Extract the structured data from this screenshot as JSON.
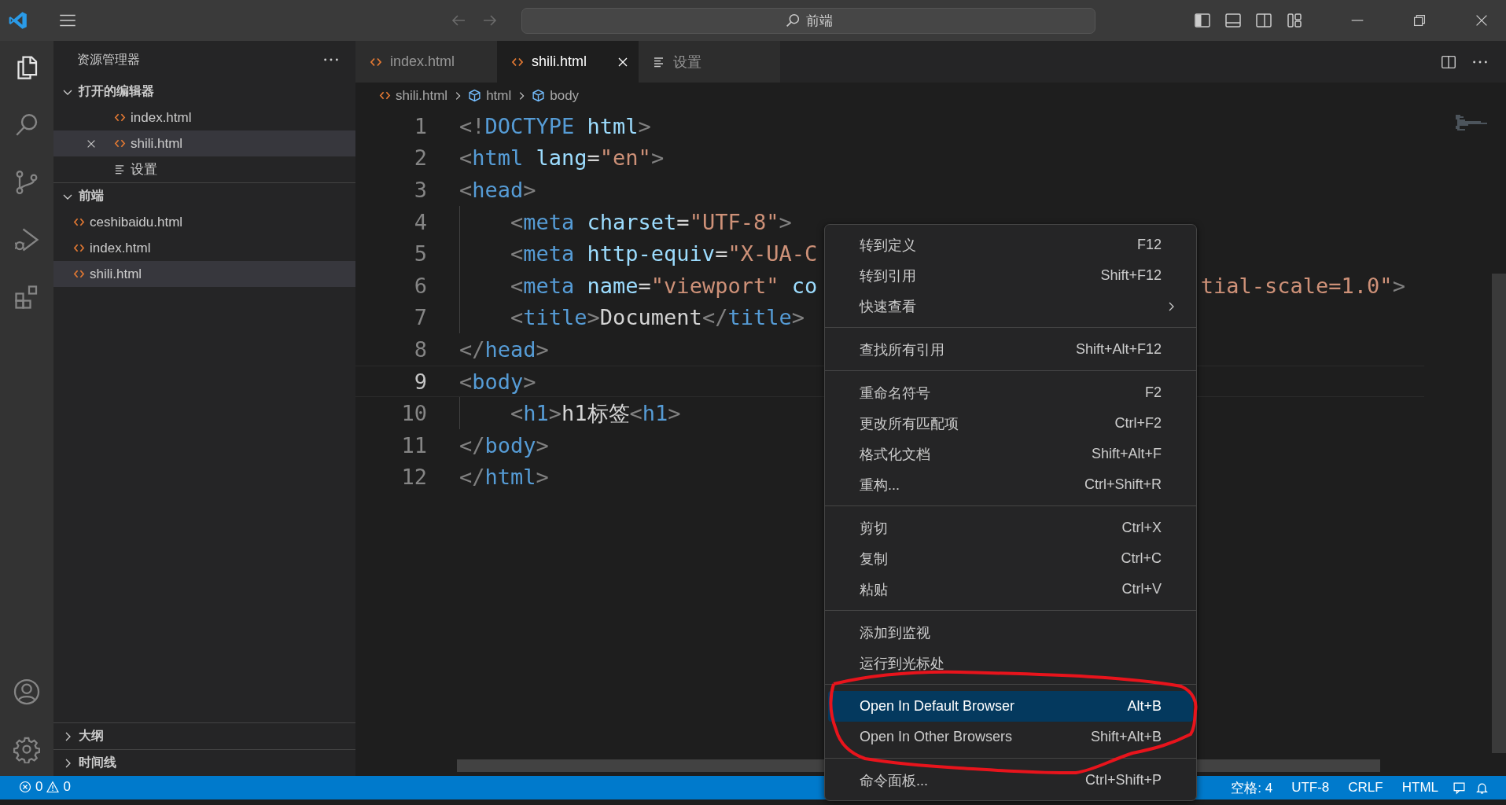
{
  "title_bar": {
    "search": "前端"
  },
  "activity_bar": [
    {
      "kind": "files",
      "selected": true
    },
    {
      "kind": "search",
      "selected": false
    },
    {
      "kind": "source-control",
      "selected": false
    },
    {
      "kind": "run-debug",
      "selected": false
    },
    {
      "kind": "extensions",
      "selected": false
    }
  ],
  "activity_bar_bottom": [
    {
      "kind": "account"
    },
    {
      "kind": "settings"
    }
  ],
  "sidebar": {
    "title": "资源管理器",
    "sections": [
      {
        "title": "打开的编辑器",
        "expanded": true,
        "items": [
          {
            "name": "index.html",
            "kind": "html",
            "selected": false
          },
          {
            "name": "shili.html",
            "kind": "html",
            "selected": true
          },
          {
            "name": "设置",
            "kind": "settings",
            "selected": false
          }
        ]
      },
      {
        "title": "前端",
        "expanded": true,
        "items": [
          {
            "name": "ceshibaidu.html",
            "kind": "html",
            "selected": false
          },
          {
            "name": "index.html",
            "kind": "html",
            "selected": false
          },
          {
            "name": "shili.html",
            "kind": "html",
            "selected": true
          }
        ]
      },
      {
        "title": "大纲",
        "expanded": false
      },
      {
        "title": "时间线",
        "expanded": false
      }
    ]
  },
  "tabs": [
    {
      "label": "index.html",
      "kind": "html",
      "selected": false
    },
    {
      "label": "shili.html",
      "kind": "html",
      "selected": true
    },
    {
      "label": "设置",
      "kind": "settings",
      "selected": false
    }
  ],
  "breadcrumb": [
    {
      "label": "shili.html",
      "kind": "html"
    },
    {
      "label": "html",
      "kind": "element"
    },
    {
      "label": "body",
      "kind": "element"
    }
  ],
  "code": [
    {
      "number": "1",
      "current": false,
      "tokens": [
        {
          "kind": "punct",
          "text": "<!"
        },
        {
          "kind": "tag",
          "text": "DOCTYPE"
        },
        {
          "kind": "attr",
          "text": " html"
        },
        {
          "kind": "punct",
          "text": ">"
        }
      ]
    },
    {
      "number": "2",
      "current": false,
      "tokens": [
        {
          "kind": "punct",
          "text": "<"
        },
        {
          "kind": "tag",
          "text": "html"
        },
        {
          "kind": "attr",
          "text": " lang"
        },
        {
          "kind": "text",
          "text": "="
        },
        {
          "kind": "string",
          "text": "\"en\""
        },
        {
          "kind": "punct",
          "text": ">"
        }
      ]
    },
    {
      "number": "3",
      "current": false,
      "tokens": [
        {
          "kind": "punct",
          "text": "<"
        },
        {
          "kind": "tag",
          "text": "head"
        },
        {
          "kind": "punct",
          "text": ">"
        }
      ]
    },
    {
      "number": "4",
      "current": false,
      "indented": true,
      "tokens": [
        {
          "kind": "punct",
          "text": "<"
        },
        {
          "kind": "tag",
          "text": "meta"
        },
        {
          "kind": "attr",
          "text": " charset"
        },
        {
          "kind": "text",
          "text": "="
        },
        {
          "kind": "string",
          "text": "\"UTF-8\""
        },
        {
          "kind": "punct",
          "text": ">"
        }
      ]
    },
    {
      "number": "5",
      "current": false,
      "indented": true,
      "tokens": [
        {
          "kind": "punct",
          "text": "<"
        },
        {
          "kind": "tag",
          "text": "meta"
        },
        {
          "kind": "attr",
          "text": " http-equiv"
        },
        {
          "kind": "text",
          "text": "="
        },
        {
          "kind": "string",
          "text": "\"X-UA-C"
        }
      ]
    },
    {
      "number": "6",
      "current": false,
      "indented": true,
      "tokens": [
        {
          "kind": "punct",
          "text": "<"
        },
        {
          "kind": "tag",
          "text": "meta"
        },
        {
          "kind": "attr",
          "text": " name"
        },
        {
          "kind": "text",
          "text": "="
        },
        {
          "kind": "string",
          "text": "\"viewport\""
        },
        {
          "kind": "attr",
          "text": " co"
        }
      ],
      "tail": [
        {
          "kind": "string",
          "text": "tial-scale=1.0\""
        },
        {
          "kind": "punct",
          "text": ">"
        }
      ]
    },
    {
      "number": "7",
      "current": false,
      "indented": true,
      "tokens": [
        {
          "kind": "punct",
          "text": "<"
        },
        {
          "kind": "tag",
          "text": "title"
        },
        {
          "kind": "punct",
          "text": ">"
        },
        {
          "kind": "text",
          "text": "Document"
        },
        {
          "kind": "punct",
          "text": "</"
        },
        {
          "kind": "tag",
          "text": "title"
        },
        {
          "kind": "punct",
          "text": ">"
        }
      ]
    },
    {
      "number": "8",
      "current": false,
      "tokens": [
        {
          "kind": "punct",
          "text": "</"
        },
        {
          "kind": "tag",
          "text": "head"
        },
        {
          "kind": "punct",
          "text": ">"
        }
      ]
    },
    {
      "number": "9",
      "current": true,
      "tokens": [
        {
          "kind": "punct",
          "text": "<"
        },
        {
          "kind": "tag",
          "text": "body"
        },
        {
          "kind": "punct",
          "text": ">"
        }
      ]
    },
    {
      "number": "10",
      "current": false,
      "indented": true,
      "tokens": [
        {
          "kind": "punct",
          "text": "<"
        },
        {
          "kind": "tag",
          "text": "h1"
        },
        {
          "kind": "punct",
          "text": ">"
        },
        {
          "kind": "text",
          "text": "h1标签"
        },
        {
          "kind": "punct",
          "text": "<"
        },
        {
          "kind": "tag",
          "text": "h1"
        },
        {
          "kind": "punct",
          "text": ">"
        }
      ]
    },
    {
      "number": "11",
      "current": false,
      "tokens": [
        {
          "kind": "punct",
          "text": "</"
        },
        {
          "kind": "tag",
          "text": "body"
        },
        {
          "kind": "punct",
          "text": ">"
        }
      ]
    },
    {
      "number": "12",
      "current": false,
      "tokens": [
        {
          "kind": "punct",
          "text": "</"
        },
        {
          "kind": "tag",
          "text": "html"
        },
        {
          "kind": "punct",
          "text": ">"
        }
      ]
    }
  ],
  "context_menu": {
    "groups": [
      [
        {
          "label": "转到定义",
          "shortcut": "F12",
          "kind": "command",
          "selected": false
        },
        {
          "label": "转到引用",
          "shortcut": "Shift+F12",
          "kind": "command",
          "selected": false
        },
        {
          "label": "快速查看",
          "kind": "submenu",
          "selected": false
        }
      ],
      [
        {
          "label": "查找所有引用",
          "shortcut": "Shift+Alt+F12",
          "kind": "command",
          "selected": false
        }
      ],
      [
        {
          "label": "重命名符号",
          "shortcut": "F2",
          "kind": "command",
          "selected": false
        },
        {
          "label": "更改所有匹配项",
          "shortcut": "Ctrl+F2",
          "kind": "command",
          "selected": false
        },
        {
          "label": "格式化文档",
          "shortcut": "Shift+Alt+F",
          "kind": "command",
          "selected": false
        },
        {
          "label": "重构...",
          "shortcut": "Ctrl+Shift+R",
          "kind": "command",
          "selected": false
        }
      ],
      [
        {
          "label": "剪切",
          "shortcut": "Ctrl+X",
          "kind": "command",
          "selected": false
        },
        {
          "label": "复制",
          "shortcut": "Ctrl+C",
          "kind": "command",
          "selected": false
        },
        {
          "label": "粘贴",
          "shortcut": "Ctrl+V",
          "kind": "command",
          "selected": false
        }
      ],
      [
        {
          "label": "添加到监视",
          "kind": "command",
          "selected": false
        },
        {
          "label": "运行到光标处",
          "kind": "command",
          "selected": false
        }
      ],
      [
        {
          "label": "Open In Default Browser",
          "shortcut": "Alt+B",
          "kind": "command",
          "selected": true
        },
        {
          "label": "Open In Other Browsers",
          "shortcut": "Shift+Alt+B",
          "kind": "command",
          "selected": false
        }
      ],
      [
        {
          "label": "命令面板...",
          "shortcut": "Ctrl+Shift+P",
          "kind": "command",
          "selected": false
        }
      ]
    ]
  },
  "status_bar": {
    "errors": "0",
    "warnings": "0",
    "items": [
      "空格: 4",
      "UTF-8",
      "CRLF",
      "HTML"
    ]
  }
}
